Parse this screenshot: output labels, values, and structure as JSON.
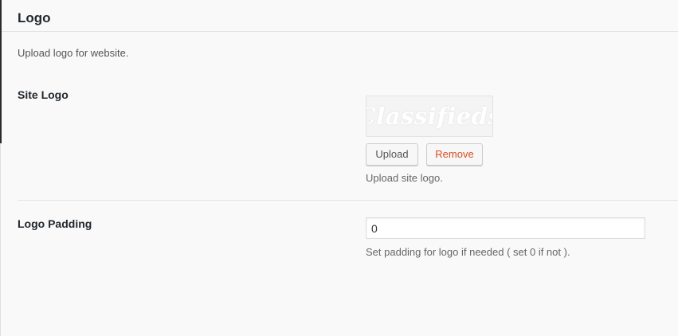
{
  "section": {
    "title": "Logo",
    "description": "Upload logo for website."
  },
  "site_logo": {
    "label": "Site Logo",
    "preview_text": "Classifieds",
    "upload_label": "Upload",
    "remove_label": "Remove",
    "help": "Upload site logo."
  },
  "logo_padding": {
    "label": "Logo Padding",
    "value": "0",
    "help": "Set padding for logo if needed ( set 0 if not )."
  },
  "colors": {
    "remove_text": "#d54e21",
    "page_background": "#f9f9f9",
    "heading_text": "#23282d"
  }
}
